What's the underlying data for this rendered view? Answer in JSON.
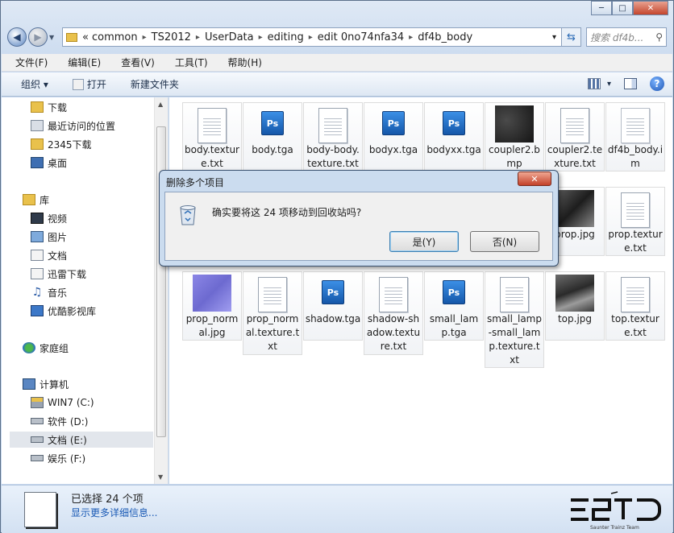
{
  "window": {
    "min": "─",
    "max": "□",
    "close": "✕"
  },
  "address": {
    "overflow": "«",
    "crumbs": [
      "common",
      "TS2012",
      "UserData",
      "editing",
      "edit 0no74nfa34",
      "df4b_body"
    ],
    "dropdown": "▾",
    "refresh": "⇆",
    "search_placeholder": "搜索 df4b..."
  },
  "menu": [
    "文件(F)",
    "编辑(E)",
    "查看(V)",
    "工具(T)",
    "帮助(H)"
  ],
  "toolbar": {
    "organize": "组织 ▾",
    "open": "打开",
    "new_folder": "新建文件夹",
    "view_dropdown": "▾",
    "help": "?"
  },
  "sidebar": {
    "favorites": [
      "下载",
      "最近访问的位置",
      "2345下载",
      "桌面"
    ],
    "libraries_header": "库",
    "libraries": [
      "视频",
      "图片",
      "文档",
      "迅雷下载",
      "音乐",
      "优酷影视库"
    ],
    "homegroup": "家庭组",
    "computer_header": "计算机",
    "drives": [
      "WIN7 (C:)",
      "软件 (D:)",
      "文档 (E:)",
      "娱乐 (F:)"
    ]
  },
  "files": [
    {
      "name": "body.texture.txt",
      "kind": "doc"
    },
    {
      "name": "body.tga",
      "kind": "ps"
    },
    {
      "name": "body-body.texture.txt",
      "kind": "doc"
    },
    {
      "name": "bodyx.tga",
      "kind": "ps"
    },
    {
      "name": "bodyxx.tga",
      "kind": "ps"
    },
    {
      "name": "coupler2.bmp",
      "kind": "thumb-dark"
    },
    {
      "name": "coupler2.texture.txt",
      "kind": "doc"
    },
    {
      "name": "df4b_body.im",
      "kind": "blank"
    },
    {
      "name": "prop.jpg",
      "kind": "thumb-mech"
    },
    {
      "name": "prop.texture.txt",
      "kind": "doc"
    },
    {
      "name": "prop_normal.jpg",
      "kind": "thumb-blue"
    },
    {
      "name": "prop_normal.texture.txt",
      "kind": "doc"
    },
    {
      "name": "shadow.tga",
      "kind": "ps"
    },
    {
      "name": "shadow-shadow.texture.txt",
      "kind": "doc"
    },
    {
      "name": "small_lamp.tga",
      "kind": "ps"
    },
    {
      "name": "small_lamp-small_lamp.texture.txt",
      "kind": "doc"
    },
    {
      "name": "top.jpg",
      "kind": "thumb-mech"
    },
    {
      "name": "top.texture.txt",
      "kind": "doc"
    }
  ],
  "status": {
    "selected": "已选择 24 个项",
    "more": "显示更多详细信息..."
  },
  "logo": {
    "team": "Saunter Trainz Team"
  },
  "dialog": {
    "title": "删除多个项目",
    "close": "✕",
    "message": "确实要将这 24 项移动到回收站吗?",
    "yes": "是(Y)",
    "no": "否(N)"
  },
  "colors": {
    "accent": "#1a5ab5",
    "folder": "#e9c14c",
    "ps": "#1f6fca",
    "close": "#c4452c"
  }
}
